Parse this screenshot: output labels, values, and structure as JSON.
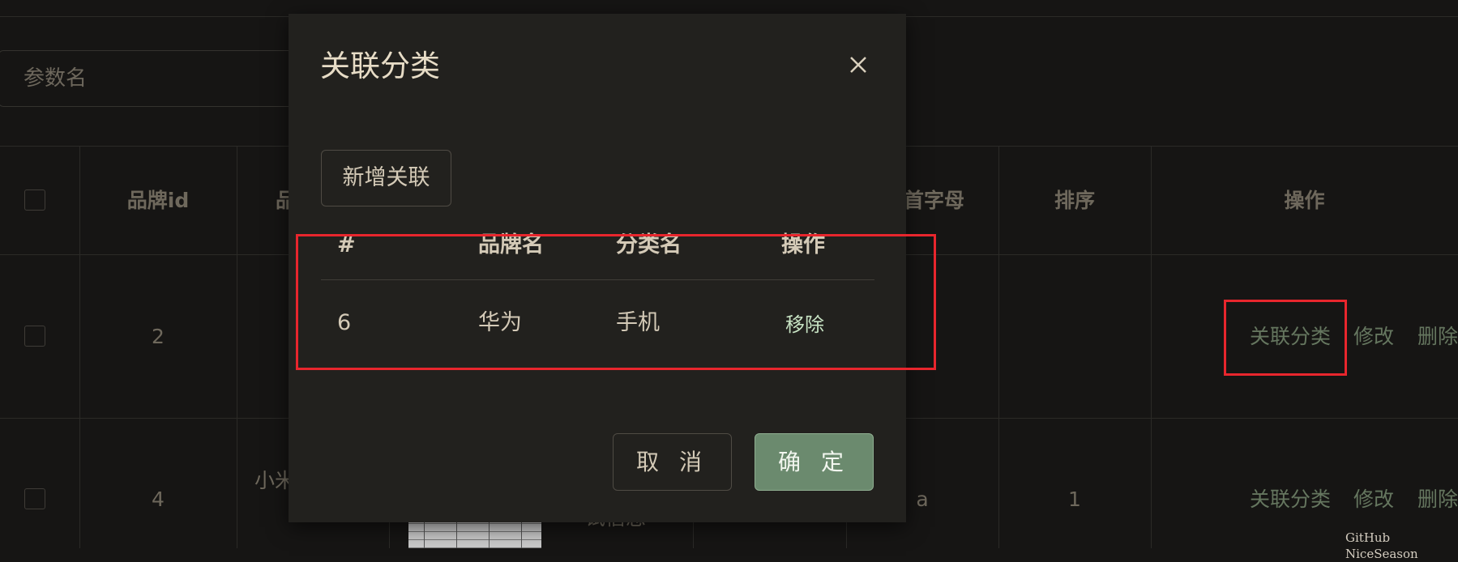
{
  "search": {
    "placeholder": "参数名"
  },
  "table": {
    "headers": [
      "品牌id",
      "品",
      "索首字母",
      "排序",
      "操作"
    ],
    "rows": [
      {
        "id": "2",
        "actions": [
          "关联分类",
          "修改",
          "删除"
        ]
      },
      {
        "id": "4",
        "name_partial": "小米",
        "desc_partial": "试信息",
        "first_letter": "a",
        "sort": "1",
        "actions": [
          "关联分类",
          "修改",
          "删除"
        ]
      }
    ]
  },
  "modal": {
    "title": "关联分类",
    "add_button": "新增关联",
    "headers": [
      "#",
      "品牌名",
      "分类名",
      "操作"
    ],
    "rows": [
      {
        "index": "6",
        "brand": "华为",
        "category": "手机",
        "action": "移除"
      }
    ],
    "cancel_button": "取 消",
    "ok_button": "确 定"
  },
  "watermark": "GitHub NiceSeason",
  "colors": {
    "accent": "#6b8a6e",
    "highlight": "#e8262d",
    "link": "#65765f"
  }
}
